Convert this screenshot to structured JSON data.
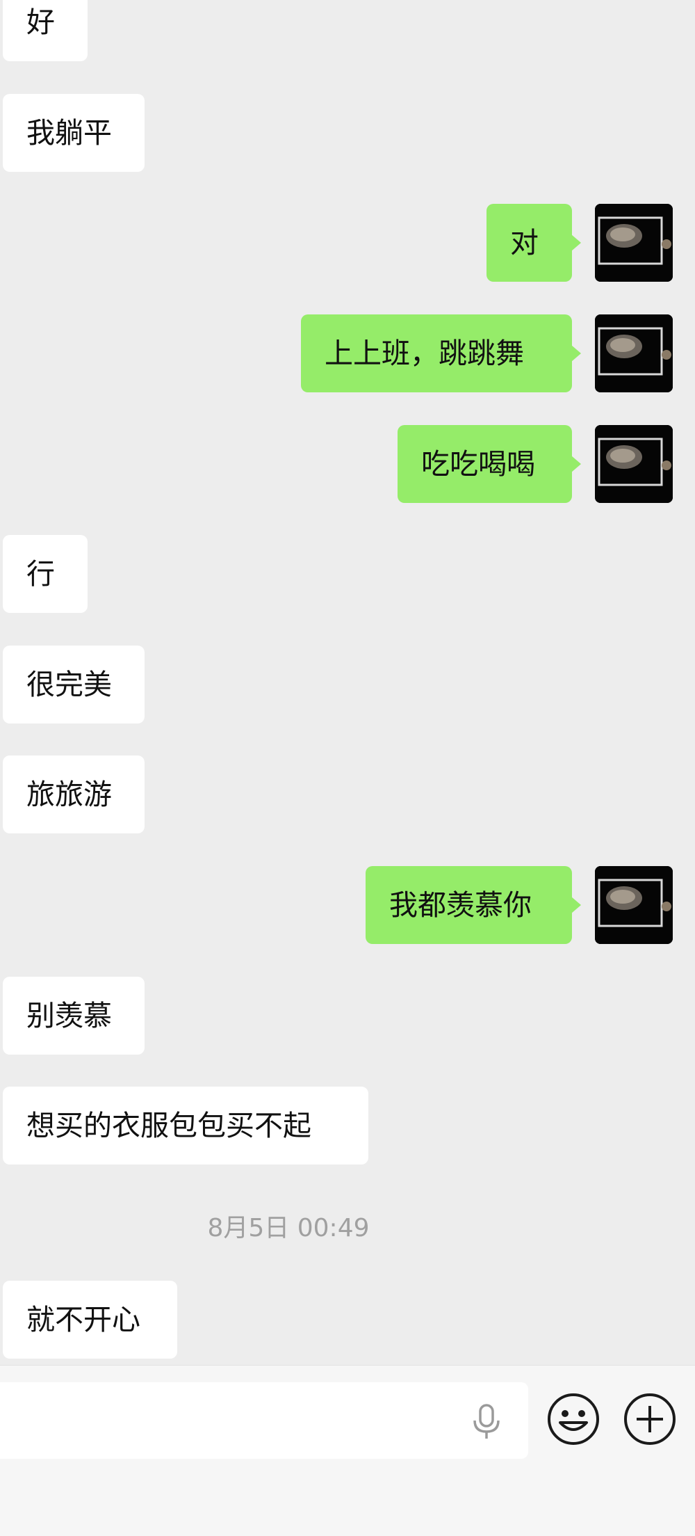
{
  "messages": [
    {
      "side": "in",
      "text": "好"
    },
    {
      "side": "in",
      "text": "我躺平"
    },
    {
      "side": "out",
      "text": "对"
    },
    {
      "side": "out",
      "text": "上上班，跳跳舞"
    },
    {
      "side": "out",
      "text": "吃吃喝喝"
    },
    {
      "side": "in",
      "text": "行"
    },
    {
      "side": "in",
      "text": "很完美"
    },
    {
      "side": "in",
      "text": "旅旅游"
    },
    {
      "side": "out",
      "text": "我都羡慕你"
    },
    {
      "side": "in",
      "text": "别羡慕"
    },
    {
      "side": "in",
      "text": "想买的衣服包包买不起"
    },
    {
      "side": "in",
      "text": "就不开心"
    }
  ],
  "timestamp": "8月5日 00:49",
  "input": {
    "value": ""
  },
  "colors": {
    "background": "#ededed",
    "outgoing_bubble": "#95ec69",
    "incoming_bubble": "#ffffff",
    "timestamp": "#a0a0a0"
  },
  "icons": [
    "voice-icon",
    "emoji-icon",
    "plus-icon"
  ]
}
